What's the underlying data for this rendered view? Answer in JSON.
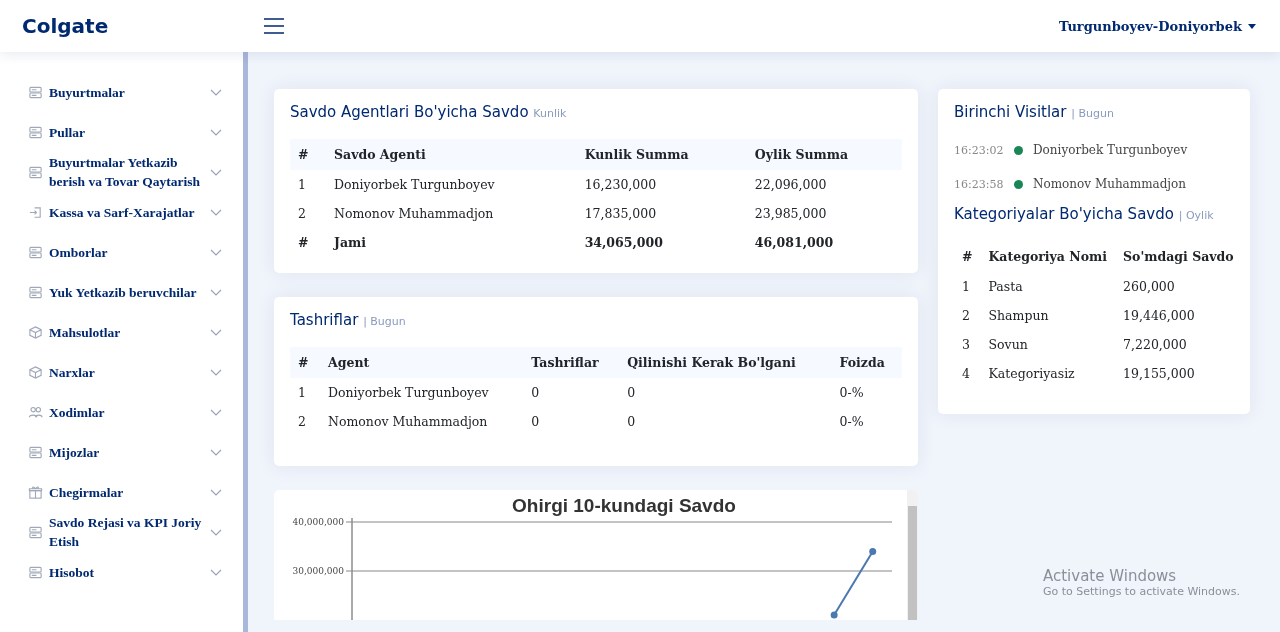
{
  "header": {
    "logo": "Colgate",
    "user": "Turgunboyev-Doniyorbek"
  },
  "sidebar": {
    "items": [
      {
        "label": "Buyurtmalar"
      },
      {
        "label": "Pullar"
      },
      {
        "label": "Buyurtmalar Yetkazib berish va Tovar Qaytarish"
      },
      {
        "label": "Kassa va Sarf-Xarajatlar"
      },
      {
        "label": "Omborlar"
      },
      {
        "label": "Yuk Yetkazib beruvchilar"
      },
      {
        "label": "Mahsulotlar"
      },
      {
        "label": "Narxlar"
      },
      {
        "label": "Xodimlar"
      },
      {
        "label": "Mijozlar"
      },
      {
        "label": "Chegirmalar"
      },
      {
        "label": "Savdo Rejasi va KPI Joriy Etish"
      },
      {
        "label": "Hisobot"
      }
    ]
  },
  "sales_card": {
    "title": "Savdo Agentlari Bo'yicha Savdo",
    "subtitle": "Kunlik",
    "columns": [
      "#",
      "Savdo Agenti",
      "Kunlik Summa",
      "Oylik Summa"
    ],
    "rows": [
      {
        "cells": [
          "1",
          "Doniyorbek Turgunboyev",
          "16,230,000",
          "22,096,000"
        ],
        "kind": "data"
      },
      {
        "cells": [
          "2",
          "Nomonov Muhammadjon",
          "17,835,000",
          "23,985,000"
        ],
        "kind": "data"
      },
      {
        "cells": [
          "#",
          "Jami",
          "34,065,000",
          "46,081,000"
        ],
        "kind": "total"
      }
    ]
  },
  "visits_card": {
    "title": "Tashriflar",
    "subtitle": "| Bugun",
    "columns": [
      "#",
      "Agent",
      "Tashriflar",
      "Qilinishi Kerak Bo'lgani",
      "Foizda"
    ],
    "rows": [
      {
        "cells": [
          "1",
          "Doniyorbek Turgunboyev",
          "0",
          "0",
          "0-%"
        ]
      },
      {
        "cells": [
          "2",
          "Nomonov Muhammadjon",
          "0",
          "0",
          "0-%"
        ]
      }
    ]
  },
  "chart_card": {
    "chart_data": {
      "type": "line",
      "title": "Ohirgi 10-kundagi Savdo",
      "ylim": [
        20000000,
        40000000
      ],
      "yticks": [
        {
          "value": 30000000,
          "label": "30,000,000"
        },
        {
          "value": 40000000,
          "label": "40,000,000"
        }
      ],
      "series": [
        {
          "color": "#4a78b0",
          "marker": true,
          "values": [
            null,
            null,
            null,
            null,
            null,
            null,
            null,
            null,
            null,
            null,
            null,
            null,
            21000000,
            34000000
          ]
        }
      ]
    }
  },
  "first_visits": {
    "title": "Birinchi Visitlar",
    "subtitle": "| Bugun",
    "items": [
      {
        "time": "16:23:02",
        "name": "Doniyorbek Turgunboyev",
        "color": "#198754"
      },
      {
        "time": "16:23:58",
        "name": "Nomonov Muhammadjon",
        "color": "#198754"
      }
    ]
  },
  "category_card": {
    "title": "Kategoriyalar Bo'yicha Savdo",
    "subtitle": "| Oylik",
    "columns": [
      "#",
      "Kategoriya Nomi",
      "So'mdagi Savdo"
    ],
    "rows": [
      {
        "cells": [
          "1",
          "Pasta",
          "260,000"
        ]
      },
      {
        "cells": [
          "2",
          "Shampun",
          "19,446,000"
        ]
      },
      {
        "cells": [
          "3",
          "Sovun",
          "7,220,000"
        ]
      },
      {
        "cells": [
          "4",
          "Kategoriyasiz",
          "19,155,000"
        ]
      }
    ]
  },
  "os_notice": {
    "title": "Activate Windows",
    "subtitle": "Go to Settings to activate Windows."
  }
}
